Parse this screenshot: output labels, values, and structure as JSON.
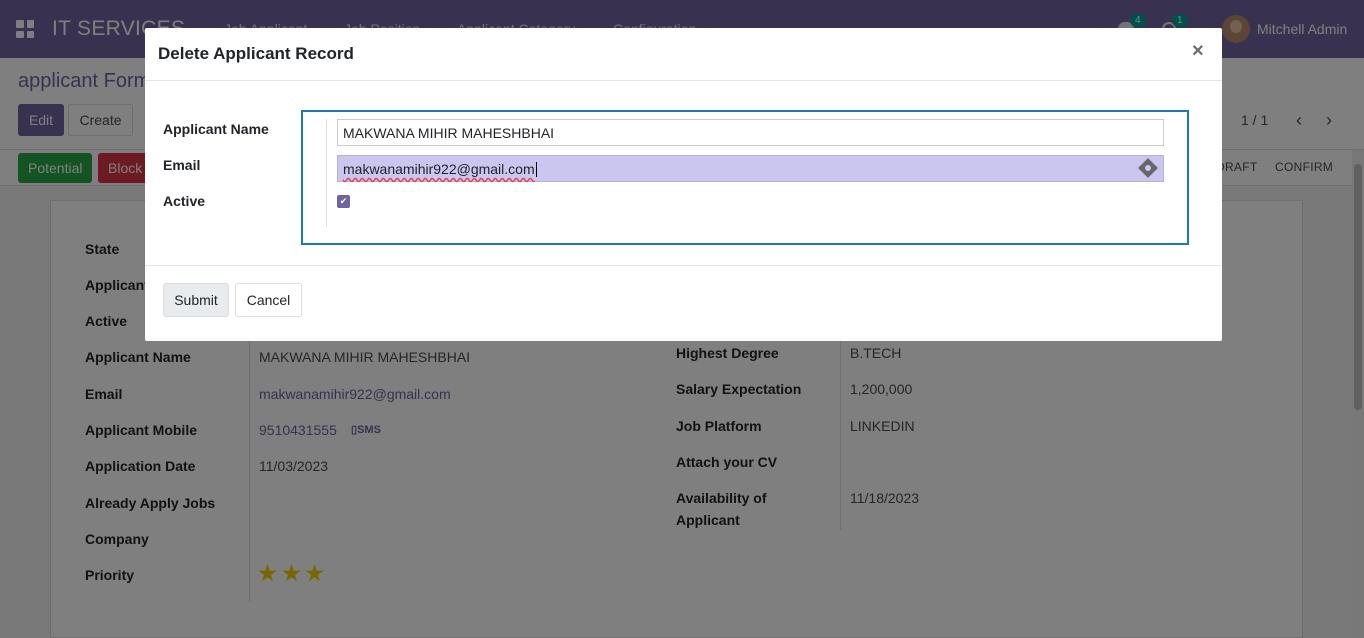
{
  "navbar": {
    "brand": "IT SERVICES",
    "menu": [
      "Job Applicant",
      "Job Position",
      "Applicant Category",
      "Configuration"
    ],
    "chat_count": "4",
    "activity_count": "1",
    "user": "Mitchell Admin"
  },
  "control_panel": {
    "breadcrumb": "applicant Form",
    "edit_label": "Edit",
    "create_label": "Create",
    "pager": "1 / 1"
  },
  "statusbar": {
    "potential_label": "Potential",
    "block_label": "Block",
    "stages": [
      "DRAFT",
      "CONFIRM"
    ]
  },
  "form": {
    "left": [
      {
        "label": "State",
        "value": ""
      },
      {
        "label": "Applicant",
        "value": ""
      },
      {
        "label": "Active",
        "value": ""
      },
      {
        "label": "Applicant Name",
        "value": "MAKWANA MIHIR MAHESHBHAI"
      },
      {
        "label": "Email",
        "value": "makwanamihir922@gmail.com"
      },
      {
        "label": "Applicant Mobile",
        "value": "9510431555"
      },
      {
        "label": "Application Date",
        "value": "11/03/2023"
      },
      {
        "label": "Already Apply Jobs",
        "value": ""
      },
      {
        "label": "Company",
        "value": ""
      },
      {
        "label": "Priority",
        "value": ""
      }
    ],
    "sms_label": "SMS",
    "priority_stars": 3,
    "right": [
      {
        "label": "Highest Degree",
        "value": "B.TECH"
      },
      {
        "label": "Salary Expectation",
        "value": "1,200,000"
      },
      {
        "label": "Job Platform",
        "value": "LINKEDIN"
      },
      {
        "label": "Attach your CV",
        "value": ""
      },
      {
        "label": "Availability of",
        "label2": "Applicant",
        "value": "11/18/2023"
      }
    ]
  },
  "modal": {
    "title": "Delete Applicant Record",
    "close": "×",
    "name_label": "Applicant Name",
    "name_value": "MAKWANA MIHIR MAHESHBHAI",
    "email_label": "Email",
    "email_value": "makwanamihir922@gmail.com",
    "active_label": "Active",
    "active_checked": true,
    "submit_label": "Submit",
    "cancel_label": "Cancel"
  },
  "colors": {
    "brand": "#71639e",
    "potential": "#28a745",
    "block": "#dc3545",
    "focus": "#1d78b5",
    "autofill": "#cbc6ef",
    "star": "#f3cc00"
  }
}
